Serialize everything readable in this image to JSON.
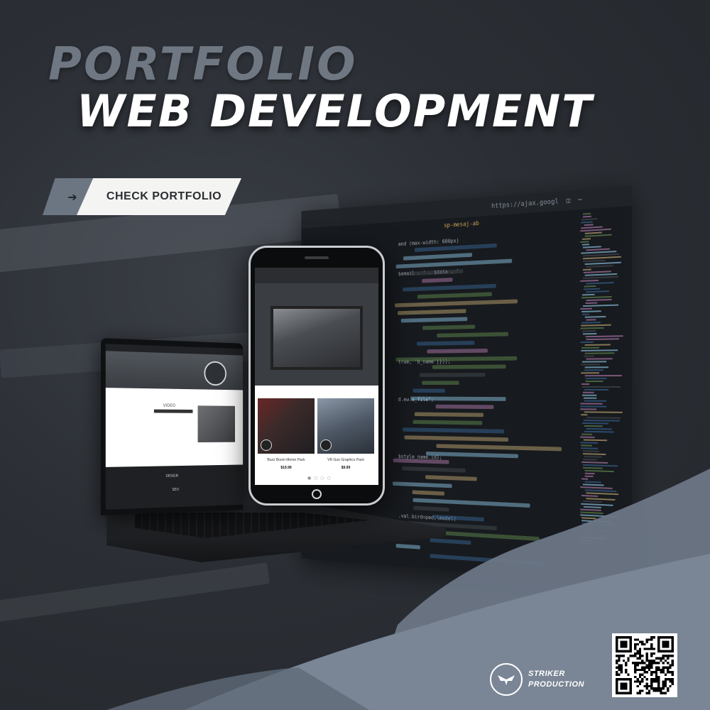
{
  "headline": {
    "line1": "PORTFOLIO",
    "line2": "WEB DEVELOPMENT"
  },
  "cta": {
    "label": "CHECK PORTFOLIO",
    "icon": "arrow-right-icon"
  },
  "code_editor": {
    "tab_text": "https://ajax.googl",
    "breadcrumb": "sp-mesaj-ab",
    "snippets": [
      "and (max-width: 600px)",
      "$email . ' . $data . '",
      "true, 'b_name'|}));",
      "d.ew.a_file\";",
      "$style_name.id);",
      ".val.bird=ped,\\model)"
    ]
  },
  "laptop": {
    "caption": "VIDEO",
    "section": "DESIGN",
    "footer": "SEO"
  },
  "phone": {
    "card1_title": "Buzz Boom Meme Pack",
    "card1_price": "$19.99",
    "card2_title": "VR Gun Graphics Pack",
    "card2_price": "$9.99",
    "dots": "● ○ ○ ○"
  },
  "brand": {
    "line1": "STRIKER",
    "line2": "PRODUCTION"
  },
  "colors": {
    "background": "#2a2e34",
    "accent_gray": "#6c7682",
    "white": "#ffffff",
    "brush": "#6b7686"
  }
}
